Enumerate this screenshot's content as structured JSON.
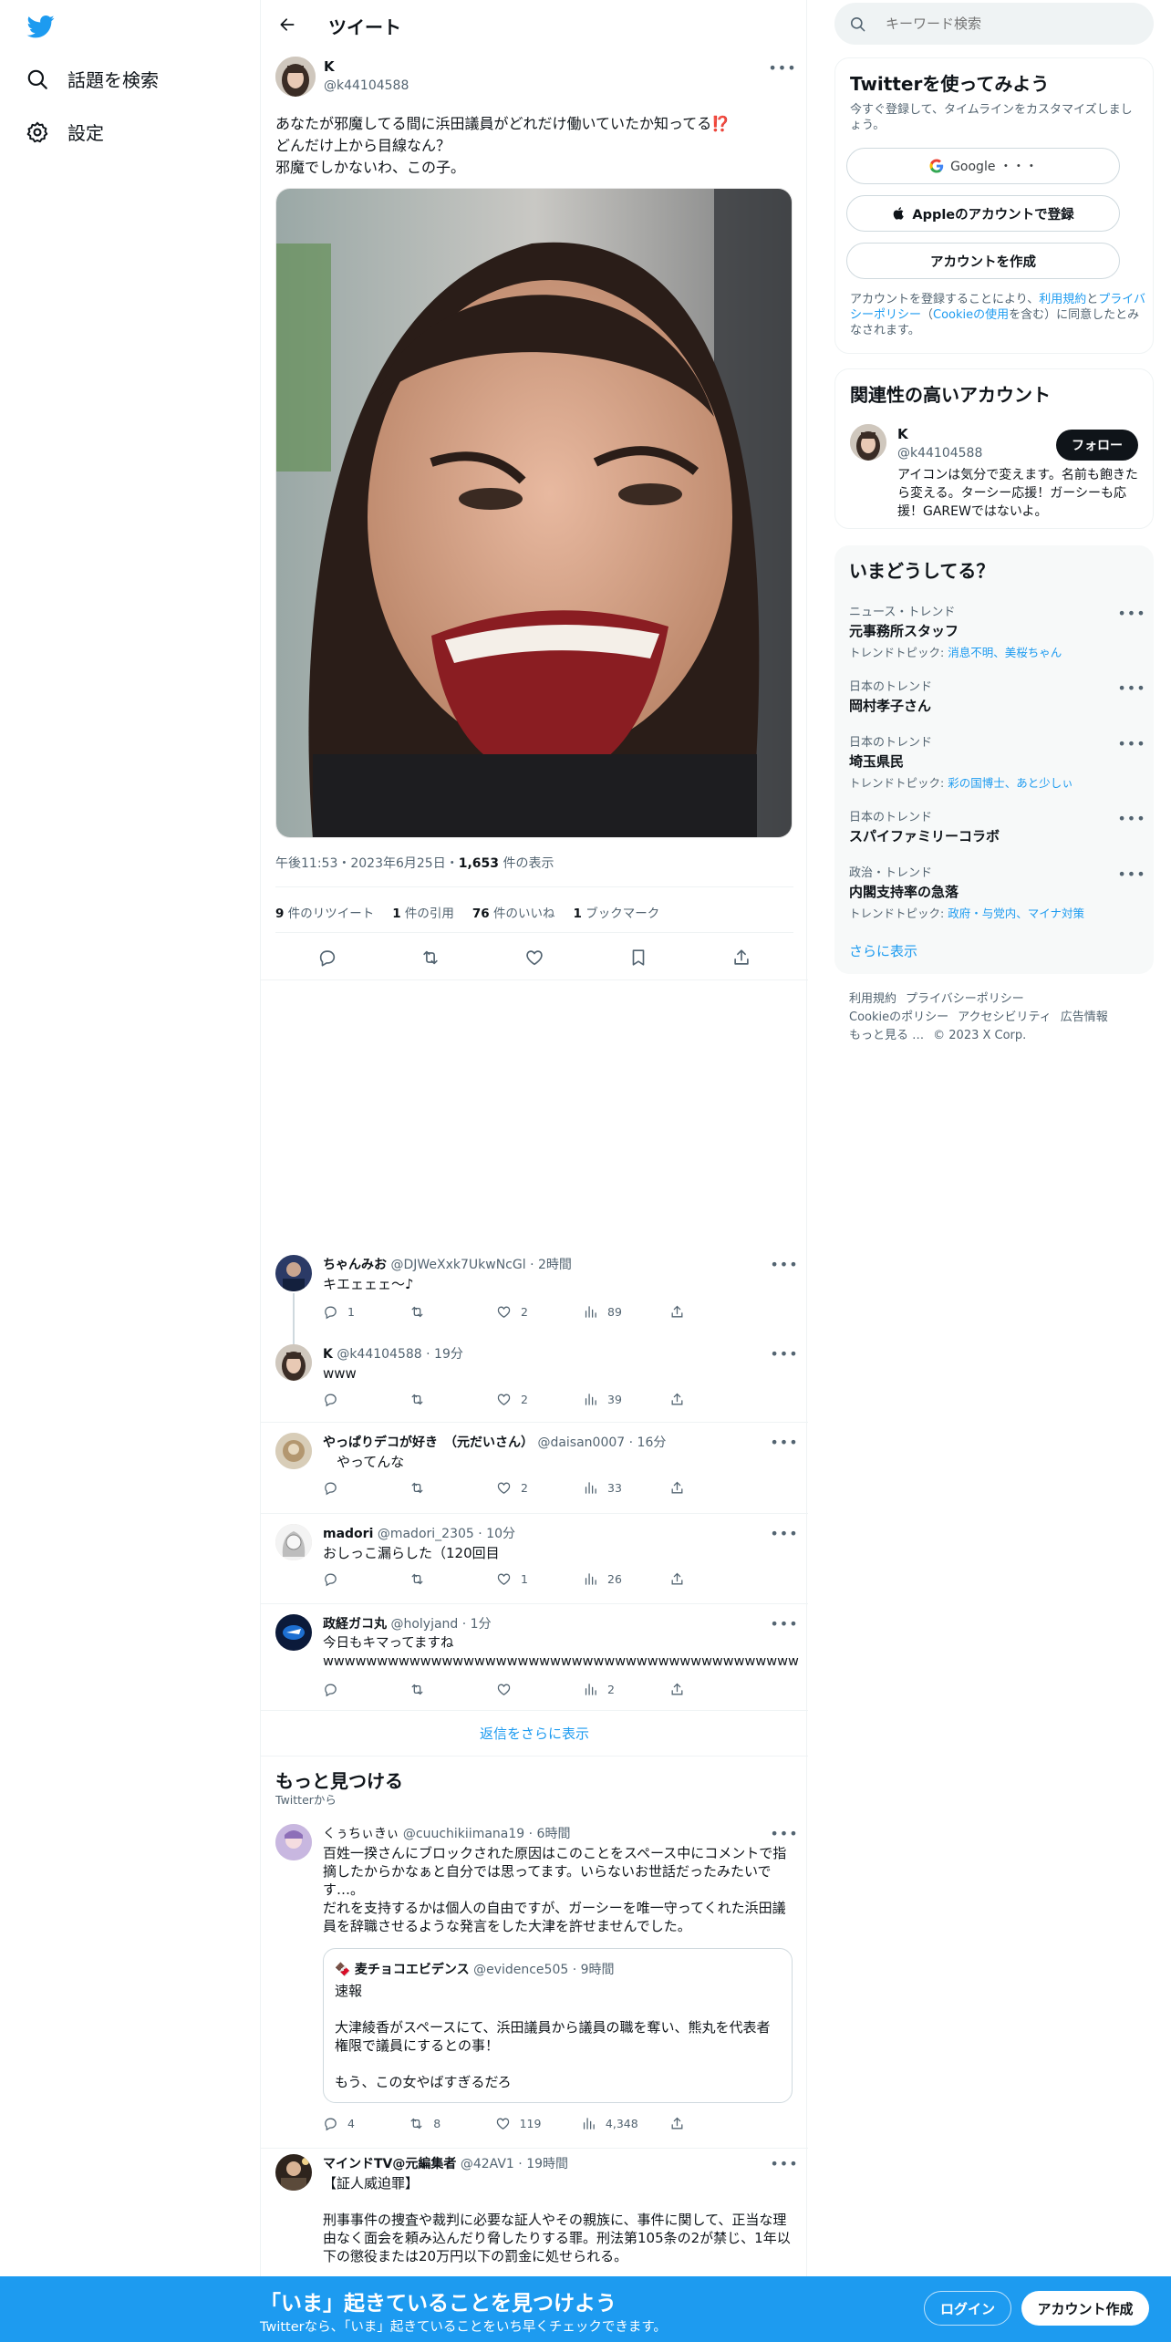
{
  "colors": {
    "brand": "#1d9bf0",
    "text": "#0f1419",
    "muted": "#536471"
  },
  "nav": {
    "explore_label": "話題を検索",
    "settings_label": "設定"
  },
  "header": {
    "title": "ツイート"
  },
  "tweet": {
    "name": "K",
    "handle": "@k44104588",
    "text": "あなたが邪魔してる間に浜田議員がどれだけ働いていたか知ってる⁉️\nどんだけ上から目線なん？\n邪魔でしかないわ、この子。",
    "time": "午後11:53・2023年6月25日・",
    "views_count": "1,653",
    "views_label": " 件の表示",
    "retweets_count": "9",
    "retweets_label": " 件のリツイート",
    "quotes_count": "1",
    "quotes_label": " 件の引用",
    "likes_count": "76",
    "likes_label": " 件のいいね",
    "bookmarks_count": "1",
    "bookmarks_label": " ブックマーク"
  },
  "replies": [
    {
      "name": "ちゃんみお",
      "handle": "@DJWeXxk7UkwNcGl",
      "time": "2時間",
      "text": "キエェェェ〜♪",
      "reply_count": "1",
      "retweet_count": "",
      "like_count": "2",
      "view_count": "89"
    },
    {
      "name": "K",
      "handle": "@k44104588",
      "time": "19分",
      "text": "www",
      "reply_count": "",
      "retweet_count": "",
      "like_count": "2",
      "view_count": "39"
    },
    {
      "name": "やっぱりデコが好き　（元だいさん）",
      "handle": "@daisan0007",
      "time": "16分",
      "text": "　やってんな",
      "reply_count": "",
      "retweet_count": "",
      "like_count": "2",
      "view_count": "33"
    },
    {
      "name": "madori",
      "handle": "@madori_2305",
      "time": "10分",
      "text": "おしっこ漏らした（120回目",
      "reply_count": "",
      "retweet_count": "",
      "like_count": "1",
      "view_count": "26"
    },
    {
      "name": "政経ガコ丸",
      "handle": "@holyjand",
      "time": "1分",
      "text": "今日もキマってますね\nwwwwwwwwwwwwwwwwwwwwwwwwwwwwwwwwwwwwwwwwwwww",
      "reply_count": "",
      "retweet_count": "",
      "like_count": "",
      "view_count": "2"
    }
  ],
  "show_more_replies": "返信をさらに表示",
  "discover": {
    "title": "もっと見つける",
    "subtitle": "Twitterから",
    "posts": [
      {
        "name": "くぅちぃきぃ",
        "handle": "@cuuchikiimana19",
        "time": "6時間",
        "text": "百姓一揆さんにブロックされた原因はこのことをスペース中にコメントで指摘したからかなぁと自分では思ってます。いらないお世話だったみたいです…。\nだれを支持するかは個人の自由ですが、ガーシーを唯一守ってくれた浜田議員を辞職させるような発言をした大津を許せませんでした。",
        "quote": {
          "name": "麦チョコエビデンス",
          "handle": "@evidence505",
          "time": "9時間",
          "text": "速報\n\n大津綾香がスペースにて、浜田議員から議員の職を奪い、熊丸を代表者権限で議員にするとの事！\n\nもう、この女やばすぎるだろ"
        },
        "reply_count": "4",
        "retweet_count": "8",
        "like_count": "119",
        "view_count": "4,348"
      },
      {
        "name": "マインドTV@元編集者",
        "handle": "@42AV1",
        "time": "19時間",
        "text": "【証人威迫罪】\n\n刑事事件の捜査や裁判に必要な証人やその親族に、事件に関して、正当な理由なく面会を頼み込んだり脅したりする罪。刑法第105条の2が禁じ、1年以下の懲役または20万円以下の罰金に処せられる。"
      }
    ]
  },
  "sidebar": {
    "search_placeholder": "キーワード検索",
    "signup_card": {
      "title": "Twitterを使ってみよう",
      "desc": "今すぐ登録して、タイムラインをカスタマイズしましょう。",
      "google_label": "Google ・・・",
      "apple_label": "Appleのアカウントで登録",
      "create_label": "アカウントを作成",
      "terms_pre": "アカウントを登録することにより、",
      "terms_link": "利用規約",
      "terms_and": "と",
      "privacy_link": "プライバシーポリシー",
      "cookie_pre": "（",
      "cookie_link": "Cookieの使用",
      "terms_post": "を含む）に同意したとみなされます。"
    },
    "related": {
      "title": "関連性の高いアカウント",
      "name": "K",
      "handle": "@k44104588",
      "follow_label": "フォロー",
      "bio": "アイコンは気分で変えます。名前も飽きたら変える。ターシー応援！ガーシーも応援！GAREWではないよ。"
    },
    "trends": {
      "title": "いまどうしてる？",
      "topics_prefix": "トレンドトピック: ",
      "items": [
        {
          "category": "ニュース・トレンド",
          "name": "元事務所スタッフ",
          "topics": "消息不明、美桜ちゃん"
        },
        {
          "category": "日本のトレンド",
          "name": "岡村孝子さん",
          "topics": ""
        },
        {
          "category": "日本のトレンド",
          "name": "埼玉県民",
          "topics": "彩の国博士、あと少しぃ"
        },
        {
          "category": "日本のトレンド",
          "name": "スパイファミリーコラボ",
          "topics": ""
        },
        {
          "category": "政治・トレンド",
          "name": "内閣支持率の急落",
          "topics": "政府・与党内、マイナ対策"
        }
      ],
      "show_more": "さらに表示"
    },
    "footer": {
      "terms": "利用規約",
      "privacy": "プライバシーポリシー",
      "cookie": "Cookieのポリシー",
      "accessibility": "アクセシビリティ",
      "ads": "広告情報",
      "more": "もっと見る …",
      "copyright": "© 2023 X Corp."
    }
  },
  "bottom_bar": {
    "title": "「いま」起きていることを見つけよう",
    "subtitle": "Twitterなら、「いま」起きていることをいち早くチェックできます。",
    "login_label": "ログイン",
    "signup_label": "アカウント作成"
  }
}
